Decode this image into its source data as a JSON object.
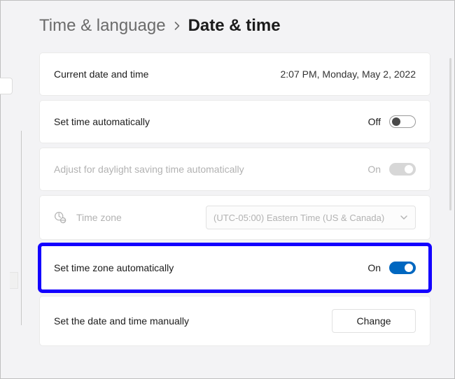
{
  "breadcrumb": {
    "parent": "Time & language",
    "current": "Date & time"
  },
  "currentDateTime": {
    "label": "Current date and time",
    "value": "2:07 PM, Monday, May 2, 2022"
  },
  "setTimeAuto": {
    "label": "Set time automatically",
    "state": "Off",
    "on": false
  },
  "daylight": {
    "label": "Adjust for daylight saving time automatically",
    "state": "On",
    "on": true,
    "disabled": true
  },
  "timeZone": {
    "label": "Time zone",
    "selected": "(UTC-05:00) Eastern Time (US & Canada)",
    "disabled": true
  },
  "setTzAuto": {
    "label": "Set time zone automatically",
    "state": "On",
    "on": true
  },
  "manual": {
    "label": "Set the date and time manually",
    "button": "Change"
  }
}
